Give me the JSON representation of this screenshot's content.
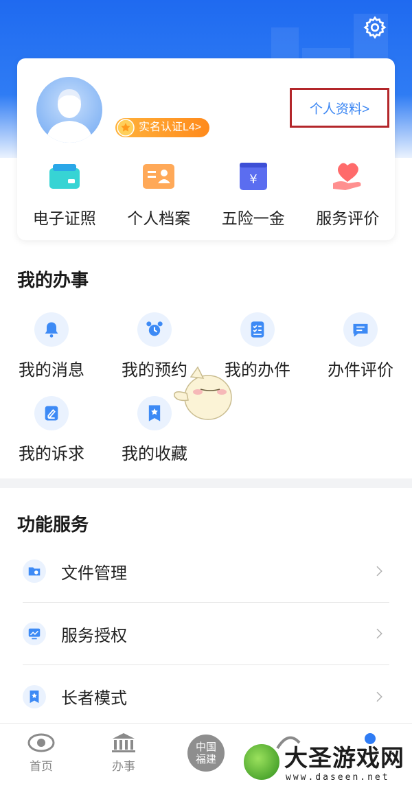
{
  "profile": {
    "verify_badge": "实名认证L4>",
    "profile_link": "个人资料>"
  },
  "quick_actions": [
    {
      "label": "电子证照",
      "icon": "id-card-icon"
    },
    {
      "label": "个人档案",
      "icon": "profile-file-icon"
    },
    {
      "label": "五险一金",
      "icon": "insurance-fund-icon"
    },
    {
      "label": "服务评价",
      "icon": "heart-hand-icon"
    }
  ],
  "my_affairs": {
    "title": "我的办事",
    "items": [
      {
        "label": "我的消息",
        "icon": "bell-icon"
      },
      {
        "label": "我的预约",
        "icon": "alarm-clock-icon"
      },
      {
        "label": "我的办件",
        "icon": "checklist-icon"
      },
      {
        "label": "办件评价",
        "icon": "comment-icon"
      },
      {
        "label": "我的诉求",
        "icon": "edit-note-icon"
      },
      {
        "label": "我的收藏",
        "icon": "bookmark-star-icon"
      }
    ]
  },
  "functions": {
    "title": "功能服务",
    "items": [
      {
        "label": "文件管理",
        "icon": "folder-icon"
      },
      {
        "label": "服务授权",
        "icon": "monitor-chart-icon"
      },
      {
        "label": "长者模式",
        "icon": "bookmark-star-icon"
      }
    ]
  },
  "tabbar": {
    "home": "首页",
    "affairs": "办事",
    "center": "中国\n福建"
  },
  "watermark": {
    "title": "大圣游戏网",
    "url": "www.daseen.net"
  },
  "colors": {
    "primary": "#2f7cf4",
    "badge_orange": "#ff8a1c",
    "highlight_box": "#b3262a"
  }
}
